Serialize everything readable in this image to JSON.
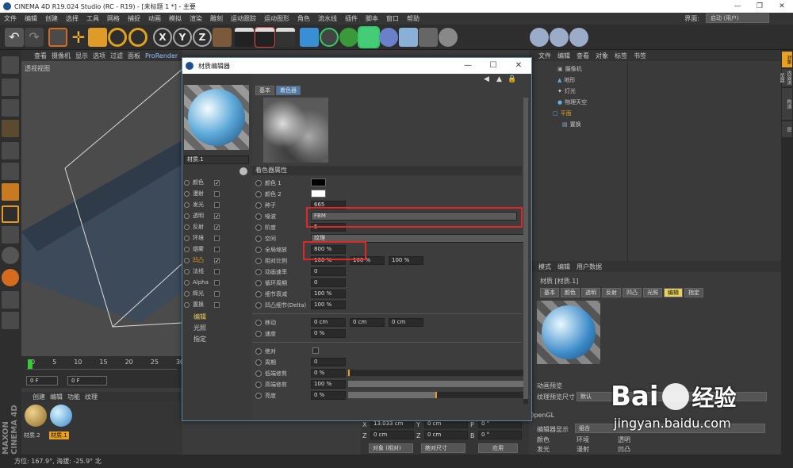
{
  "window": {
    "title": "CINEMA 4D R19.024 Studio (RC - R19) - [未标题 1 *] - 主要",
    "min": "—",
    "max": "❐",
    "close": "✕"
  },
  "menu": [
    "文件",
    "编辑",
    "创建",
    "选择",
    "工具",
    "网格",
    "捕捉",
    "动画",
    "模拟",
    "渲染",
    "雕刻",
    "运动跟踪",
    "运动图形",
    "角色",
    "流水线",
    "插件",
    "脚本",
    "窗口",
    "帮助"
  ],
  "layout_label": "界面:",
  "layout_value": "启动 (用户)",
  "viewport": {
    "menu": [
      "查看",
      "摄像机",
      "显示",
      "选项",
      "过滤",
      "面板",
      "ProRender"
    ],
    "label": "透视视图"
  },
  "timeline": {
    "ticks": [
      "0",
      "5",
      "10",
      "15",
      "20",
      "25",
      "30"
    ],
    "start": "0 F",
    "current": "0 F"
  },
  "matmgr": {
    "menu": [
      "创建",
      "编辑",
      "功能",
      "纹理"
    ],
    "materials": [
      "材质.2",
      "材质.1"
    ]
  },
  "status": "方位: 167.9°, 海拔: -25.9° 北",
  "objects": {
    "menu": [
      "文件",
      "编辑",
      "查看",
      "对象",
      "标签",
      "书签"
    ],
    "items": [
      "摄像机",
      "地形",
      "灯光",
      "物理天空",
      "平面",
      "置换"
    ]
  },
  "attr": {
    "menu": [
      "模式",
      "编辑",
      "用户数据"
    ],
    "title": "材质 [材质.1]",
    "tabs": [
      "基本",
      "颜色",
      "透明",
      "反射",
      "凹凸",
      "光照",
      "编辑",
      "指定"
    ],
    "anim_preview": "动画预览",
    "tex_size_label": "纹理预览尺寸",
    "tex_size_value": "默认",
    "opengl": "OpenGL",
    "display_label": "编辑器显示",
    "display_value": "组合",
    "props": [
      "颜色",
      "发光",
      "环境",
      "漫射",
      "透明",
      "凹凸"
    ]
  },
  "coords": {
    "rows": [
      [
        "X",
        "13.033 cm",
        "Y",
        "0 cm",
        "P",
        "0 °"
      ],
      [
        "Z",
        "0 cm",
        "Z",
        "0 cm",
        "B",
        "0 °"
      ]
    ],
    "obj_mode": "对象 (相对)",
    "size_mode": "绝对尺寸",
    "apply": "应用"
  },
  "right_tabs": [
    "对象",
    "内容浏览器",
    "构造",
    "层"
  ],
  "dialog": {
    "title": "材质编辑器",
    "mat_name": "材质.1",
    "channels": [
      {
        "label": "颜色",
        "on": true
      },
      {
        "label": "漫射",
        "on": false
      },
      {
        "label": "发光",
        "on": false
      },
      {
        "label": "透明",
        "on": true
      },
      {
        "label": "反射",
        "on": true
      },
      {
        "label": "环境",
        "on": false
      },
      {
        "label": "烟雾",
        "on": false
      },
      {
        "label": "凹凸",
        "on": true
      },
      {
        "label": "法线",
        "on": false
      },
      {
        "label": "Alpha",
        "on": false
      },
      {
        "label": "辉光",
        "on": false
      },
      {
        "label": "置换",
        "on": false
      }
    ],
    "sections": [
      "编辑",
      "光照",
      "指定"
    ],
    "tabs": [
      "基本",
      "着色器"
    ],
    "group": "着色器属性",
    "params": [
      {
        "label": "颜色 1",
        "type": "color",
        "value": "#000000"
      },
      {
        "label": "颜色 2",
        "type": "color",
        "value": "#ffffff"
      },
      {
        "label": "种子",
        "type": "text",
        "value": "665"
      },
      {
        "label": "噪波",
        "type": "select",
        "value": "FBM"
      },
      {
        "label": "阶度",
        "type": "text",
        "value": "5"
      },
      {
        "label": "空间",
        "type": "select",
        "value": "纹理"
      },
      {
        "label": "全局缩放",
        "type": "text",
        "value": "800 %"
      },
      {
        "label": "相对比例",
        "type": "triple",
        "value": [
          "100 %",
          "100 %",
          "100 %"
        ]
      },
      {
        "label": "动画速率",
        "type": "text",
        "value": "0"
      },
      {
        "label": "循环周期",
        "type": "text",
        "value": "0"
      },
      {
        "label": "细节衰减",
        "type": "text",
        "value": "100 %"
      },
      {
        "label": "凹凸细节(Delta)",
        "type": "text",
        "value": "100 %"
      },
      {
        "label": "移动",
        "type": "triple",
        "value": [
          "0 cm",
          "0 cm",
          "0 cm"
        ]
      },
      {
        "label": "速度",
        "type": "text",
        "value": "0 %"
      },
      {
        "label": "绝对",
        "type": "check",
        "value": ""
      },
      {
        "label": "周期",
        "type": "text",
        "value": "0"
      },
      {
        "label": "低端修剪",
        "type": "slider",
        "value": "0 %",
        "fill": 0
      },
      {
        "label": "高端修剪",
        "type": "slider",
        "value": "100 %",
        "fill": 1
      },
      {
        "label": "亮度",
        "type": "slider",
        "value": "0 %",
        "fill": 0.5
      }
    ]
  },
  "watermark": {
    "brand": "Bai",
    "brand2": "经验",
    "url": "jingyan.baidu.com"
  }
}
